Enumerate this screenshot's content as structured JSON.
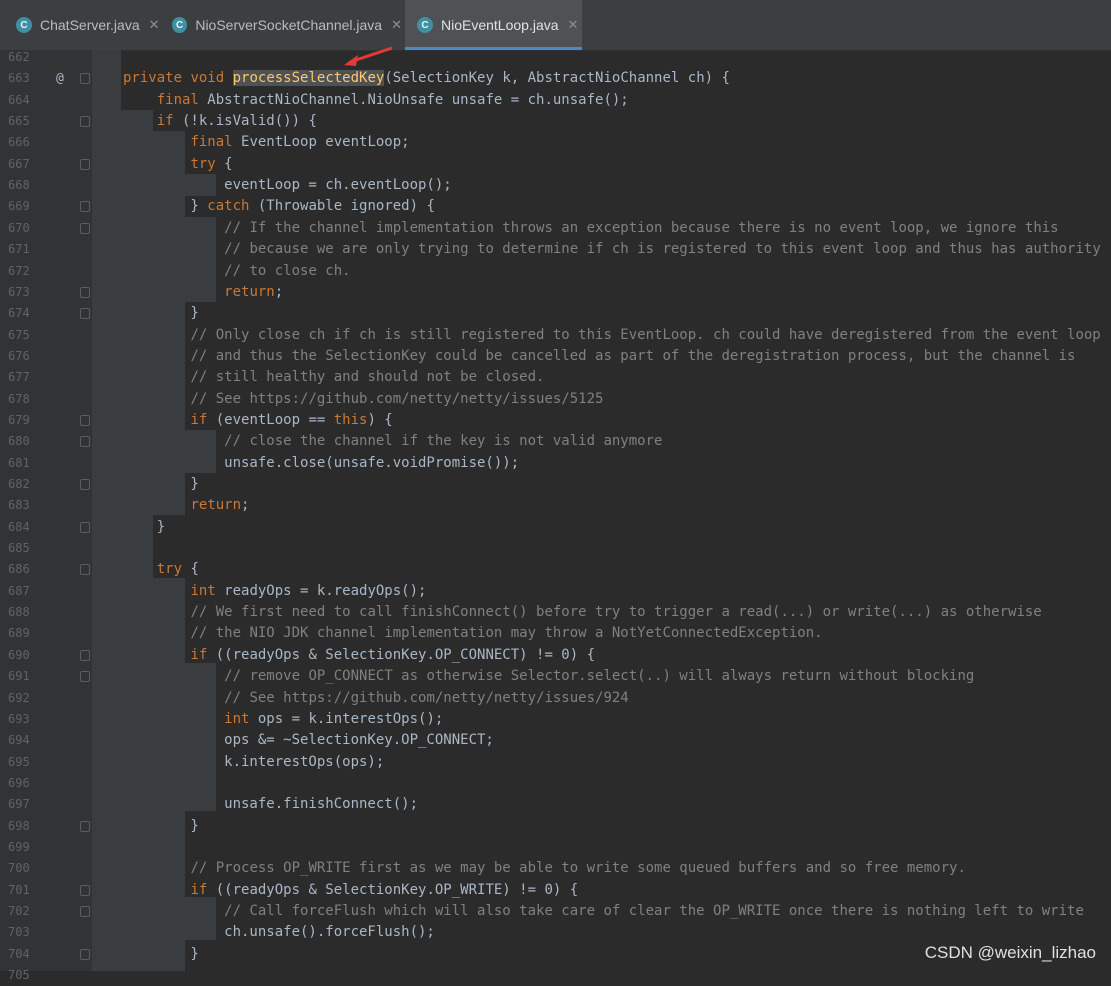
{
  "tabs": [
    {
      "label": "ChatServer.java",
      "active": false
    },
    {
      "label": "NioServerSocketChannel.java",
      "active": false
    },
    {
      "label": "NioEventLoop.java",
      "active": true
    }
  ],
  "tab_icon_letter": "C",
  "gutter_marks": {
    "override": "@"
  },
  "lines": [
    {
      "n": "662",
      "code": ""
    },
    {
      "n": "663",
      "code": "private void processSelectedKey(SelectionKey k, AbstractNioChannel ch) {"
    },
    {
      "n": "664",
      "code": "    final AbstractNioChannel.NioUnsafe unsafe = ch.unsafe();"
    },
    {
      "n": "665",
      "code": "    if (!k.isValid()) {"
    },
    {
      "n": "666",
      "code": "        final EventLoop eventLoop;"
    },
    {
      "n": "667",
      "code": "        try {"
    },
    {
      "n": "668",
      "code": "            eventLoop = ch.eventLoop();"
    },
    {
      "n": "669",
      "code": "        } catch (Throwable ignored) {"
    },
    {
      "n": "670",
      "code": "            // If the channel implementation throws an exception because there is no event loop, we ignore this"
    },
    {
      "n": "671",
      "code": "            // because we are only trying to determine if ch is registered to this event loop and thus has authority"
    },
    {
      "n": "672",
      "code": "            // to close ch."
    },
    {
      "n": "673",
      "code": "            return;"
    },
    {
      "n": "674",
      "code": "        }"
    },
    {
      "n": "675",
      "code": "        // Only close ch if ch is still registered to this EventLoop. ch could have deregistered from the event loop"
    },
    {
      "n": "676",
      "code": "        // and thus the SelectionKey could be cancelled as part of the deregistration process, but the channel is"
    },
    {
      "n": "677",
      "code": "        // still healthy and should not be closed."
    },
    {
      "n": "678",
      "code": "        // See https://github.com/netty/netty/issues/5125"
    },
    {
      "n": "679",
      "code": "        if (eventLoop == this) {"
    },
    {
      "n": "680",
      "code": "            // close the channel if the key is not valid anymore"
    },
    {
      "n": "681",
      "code": "            unsafe.close(unsafe.voidPromise());"
    },
    {
      "n": "682",
      "code": "        }"
    },
    {
      "n": "683",
      "code": "        return;"
    },
    {
      "n": "684",
      "code": "    }"
    },
    {
      "n": "685",
      "code": ""
    },
    {
      "n": "686",
      "code": "    try {"
    },
    {
      "n": "687",
      "code": "        int readyOps = k.readyOps();"
    },
    {
      "n": "688",
      "code": "        // We first need to call finishConnect() before try to trigger a read(...) or write(...) as otherwise"
    },
    {
      "n": "689",
      "code": "        // the NIO JDK channel implementation may throw a NotYetConnectedException."
    },
    {
      "n": "690",
      "code": "        if ((readyOps & SelectionKey.OP_CONNECT) != 0) {"
    },
    {
      "n": "691",
      "code": "            // remove OP_CONNECT as otherwise Selector.select(..) will always return without blocking"
    },
    {
      "n": "692",
      "code": "            // See https://github.com/netty/netty/issues/924"
    },
    {
      "n": "693",
      "code": "            int ops = k.interestOps();"
    },
    {
      "n": "694",
      "code": "            ops &= ~SelectionKey.OP_CONNECT;"
    },
    {
      "n": "695",
      "code": "            k.interestOps(ops);"
    },
    {
      "n": "696",
      "code": ""
    },
    {
      "n": "697",
      "code": "            unsafe.finishConnect();"
    },
    {
      "n": "698",
      "code": "        }"
    },
    {
      "n": "699",
      "code": ""
    },
    {
      "n": "700",
      "code": "        // Process OP_WRITE first as we may be able to write some queued buffers and so free memory."
    },
    {
      "n": "701",
      "code": "        if ((readyOps & SelectionKey.OP_WRITE) != 0) {"
    },
    {
      "n": "702",
      "code": "            // Call forceFlush which will also take care of clear the OP_WRITE once there is nothing left to write"
    },
    {
      "n": "703",
      "code": "            ch.unsafe().forceFlush();"
    },
    {
      "n": "704",
      "code": "        }"
    },
    {
      "n": "705",
      "code": ""
    }
  ],
  "colors": {
    "keyword": "#cc7832",
    "method_decl": "#ffc66d",
    "comment": "#808080",
    "text": "#a9b7c6",
    "accent": "#4a88c7"
  },
  "watermark": "CSDN @weixin_lizhao"
}
